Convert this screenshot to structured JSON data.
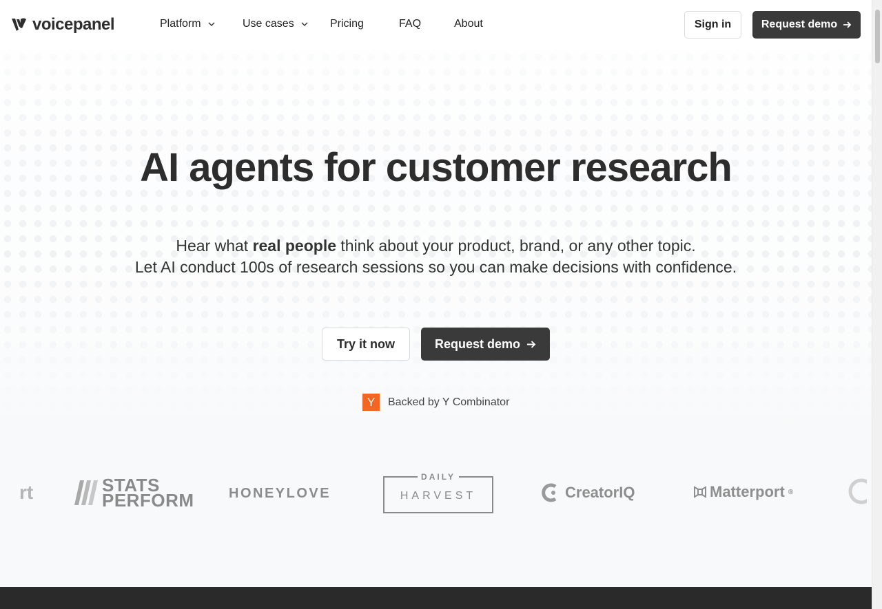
{
  "nav": {
    "brand": "voicepanel",
    "items": [
      {
        "label": "Platform",
        "has_dropdown": true
      },
      {
        "label": "Use cases",
        "has_dropdown": true
      },
      {
        "label": "Pricing",
        "has_dropdown": false
      },
      {
        "label": "FAQ",
        "has_dropdown": false
      },
      {
        "label": "About",
        "has_dropdown": false
      }
    ],
    "sign_in": "Sign in",
    "request_demo": "Request demo"
  },
  "hero": {
    "title": "AI agents for customer research",
    "sub_line1_pre": "Hear what ",
    "sub_line1_bold": "real people",
    "sub_line1_post": " think about your product, brand, or any other topic.",
    "sub_line2": "Let AI conduct 100s of research sessions so you can make decisions with confidence.",
    "try_button": "Try it now",
    "demo_button": "Request demo",
    "backed_badge": "Y",
    "backed_text": "Backed by Y Combinator"
  },
  "logos": {
    "fragment": "rt",
    "stats_line1": "STATS",
    "stats_line2": "PERFORM",
    "honeylove": "HONEYLOVE",
    "harvest_top": "DAILY",
    "harvest_main": "HARVEST",
    "creatoriq": "CreatorIQ",
    "matterport": "Matterport",
    "matterport_mark": "®"
  },
  "colors": {
    "dark_button": "#3a3a3a",
    "yc_orange": "#f26522",
    "logo_gray": "#8e8e8e"
  }
}
